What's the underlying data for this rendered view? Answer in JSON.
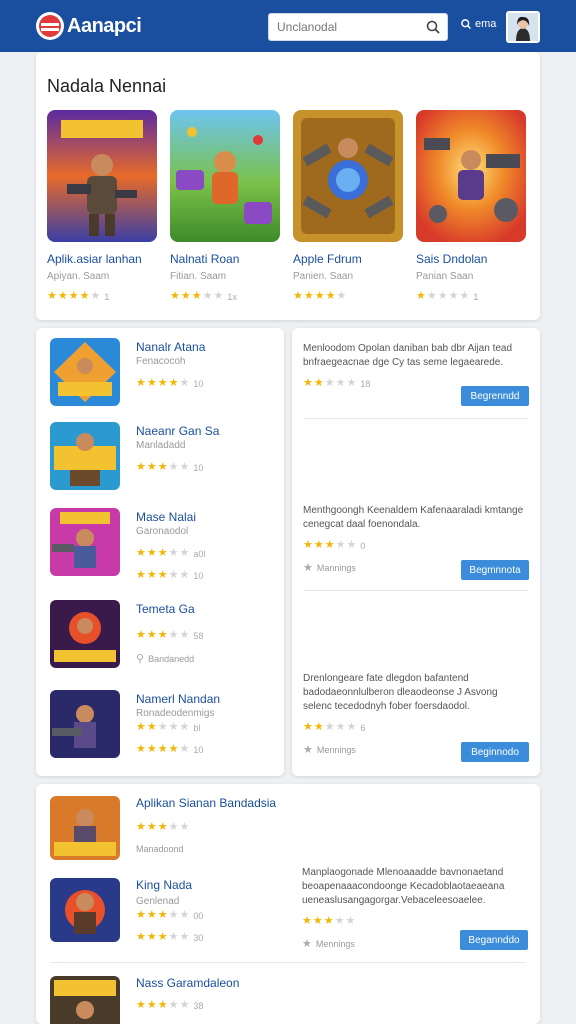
{
  "header": {
    "logo_text": "Aanapci",
    "search_placeholder": "Unclanodal",
    "search_label": "ema"
  },
  "featured": {
    "title": "Nadala Nennai",
    "items": [
      {
        "title": "Aplik.asiar lanhan",
        "sub": "Apiyan. Saam",
        "rating": 4,
        "rating_text": "1"
      },
      {
        "title": "Nalnati Roan",
        "sub": "Fitian. Saam",
        "rating": 3,
        "rating_text": "1x"
      },
      {
        "title": "Apple Fdrum",
        "sub": "Panien. Saan",
        "rating": 4,
        "rating_text": ""
      },
      {
        "title": "Sais Dndolan",
        "sub": "Panian Saan",
        "rating": 1,
        "rating_text": "1"
      }
    ]
  },
  "list_left": [
    {
      "title": "Nanalr Atana",
      "sub": "Fenacocoh",
      "rating": 4,
      "rating_text": "10"
    },
    {
      "title": "Naeanr Gan Sa",
      "sub": "Manladadd",
      "rating": 3,
      "rating_text": "10"
    },
    {
      "title": "Mase Nalai",
      "sub": "Garonaodol",
      "rating": 3,
      "rating_text": "a0l",
      "rating2": 3,
      "rating2_text": "10"
    },
    {
      "title": "Temeta Ga",
      "sub": "",
      "rating": 3,
      "rating_text": "58",
      "extra": "Bandanedd"
    },
    {
      "title": "Namerl Nandan",
      "sub": "Ronadeodenmigs",
      "rating": 2,
      "rating_text": "bl",
      "rating2": 4,
      "rating2_text": "10"
    }
  ],
  "list_right": [
    {
      "desc": "Menloodom Opolan daniban bab dbr Aijan tead bnfraegeacnae dge Cy tas seme legaearede.",
      "rating": 2,
      "rating_text": "18",
      "meta": "",
      "button": "Begrenndd"
    },
    {
      "desc": "Menthgoongh Keenaldem Kafenaaraladi kmtange cenegcat daal foenondala.",
      "rating": 3,
      "rating_text": "0",
      "meta": "Mannings",
      "button": "Begmnnota"
    },
    {
      "desc": "Drenlongeare fate dlegdon bafantend badodaeonnlulberon dleaodeonse J Asvong selenc tecedodnyh fober foersdaodol.",
      "rating": 2,
      "rating_text": "6",
      "meta": "Mennings",
      "button": "Beginnodo"
    }
  ],
  "bottom": [
    {
      "title": "Aplikan Sianan Bandadsia",
      "sub": "",
      "rating": 3,
      "rating_text": "",
      "meta": "Manadoond"
    },
    {
      "title": "King Nada",
      "sub": "Genlenad",
      "rating": 3,
      "rating_text": "00",
      "rating2": 3,
      "rating2_text": "30"
    },
    {
      "title": "Nass Garamdaleon",
      "sub": "",
      "rating": 3,
      "rating_text": "38"
    }
  ],
  "bottom_right": {
    "desc": "Manplaogonade Mlenoaaadde bavnonaetand beoapenaaacondoonge Kecadoblaotaeaeana ueneaslusangagorgar.Vebaceleesoaelee.",
    "rating": 3,
    "meta": "Mennings",
    "button": "Begannddo"
  }
}
